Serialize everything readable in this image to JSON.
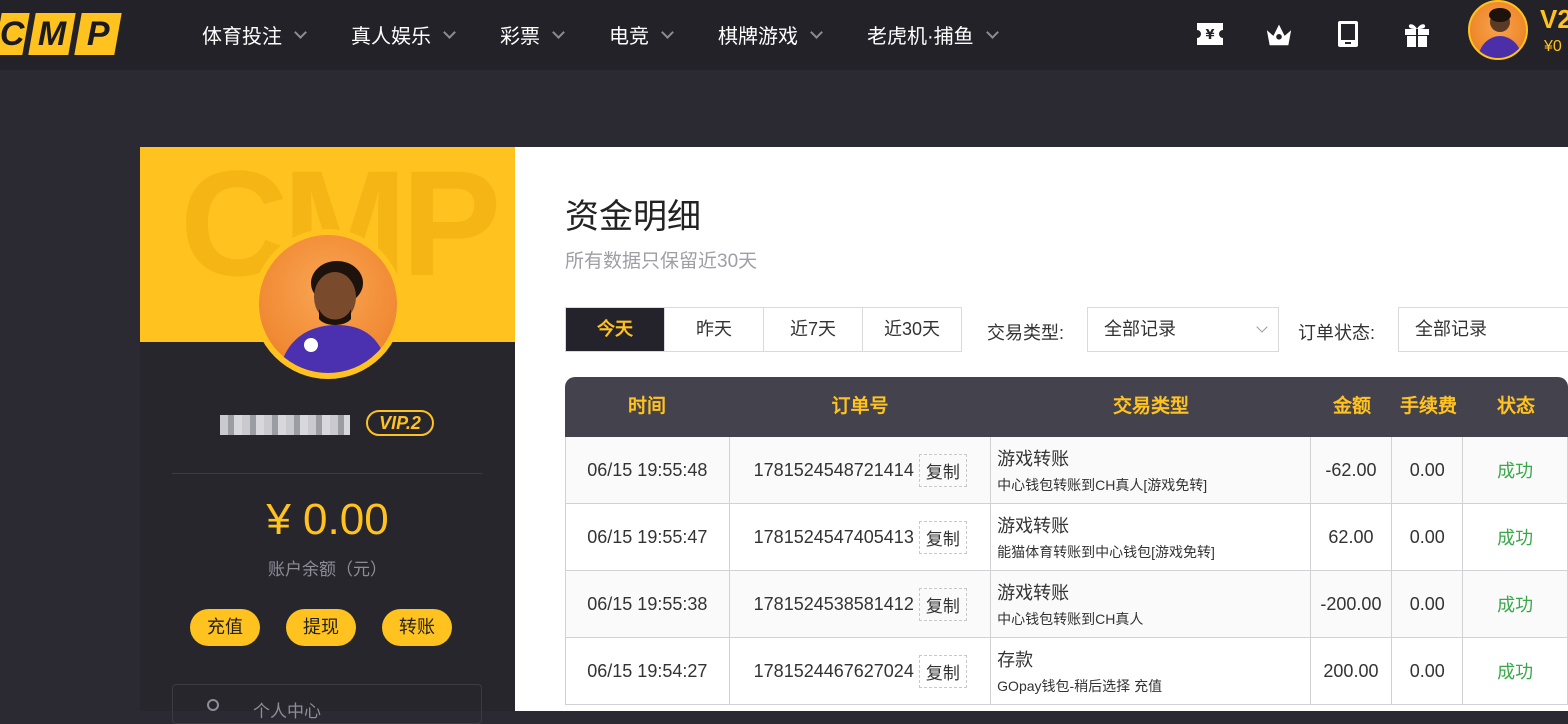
{
  "header": {
    "logo_letters": [
      "C",
      "M",
      "P"
    ],
    "nav": [
      {
        "label": "体育投注"
      },
      {
        "label": "真人娱乐"
      },
      {
        "label": "彩票"
      },
      {
        "label": "电竞"
      },
      {
        "label": "棋牌游戏"
      },
      {
        "label": "老虎机·捕鱼"
      }
    ],
    "icons": [
      "yen-ticket-icon",
      "crown-icon",
      "tablet-icon",
      "gift-icon"
    ],
    "vip": "V2",
    "balance": "¥0"
  },
  "profile": {
    "vip_badge": "VIP.2",
    "balance": "¥ 0.00",
    "balance_label": "账户余额（元）",
    "actions": [
      {
        "label": "充值"
      },
      {
        "label": "提现"
      },
      {
        "label": "转账"
      }
    ],
    "menu_first": "个人中心"
  },
  "main": {
    "title": "资金明细",
    "subtitle": "所有数据只保留近30天",
    "tabs": [
      {
        "label": "今天",
        "active": true
      },
      {
        "label": "昨天"
      },
      {
        "label": "近7天"
      },
      {
        "label": "近30天"
      }
    ],
    "filter_type_label": "交易类型:",
    "filter_type_value": "全部记录",
    "filter_status_label": "订单状态:",
    "filter_status_value": "全部记录",
    "columns": [
      "时间",
      "订单号",
      "交易类型",
      "金额",
      "手续费",
      "状态"
    ],
    "copy_label": "复制",
    "rows": [
      {
        "time": "06/15 19:55:48",
        "order": "1781524548721414",
        "type": "游戏转账",
        "desc": "中心钱包转账到CH真人[游戏免转]",
        "amount": "-62.00",
        "fee": "0.00",
        "status": "成功"
      },
      {
        "time": "06/15 19:55:47",
        "order": "1781524547405413",
        "type": "游戏转账",
        "desc": "能猫体育转账到中心钱包[游戏免转]",
        "amount": "62.00",
        "fee": "0.00",
        "status": "成功"
      },
      {
        "time": "06/15 19:55:38",
        "order": "1781524538581412",
        "type": "游戏转账",
        "desc": "中心钱包转账到CH真人",
        "amount": "-200.00",
        "fee": "0.00",
        "status": "成功"
      },
      {
        "time": "06/15 19:54:27",
        "order": "1781524467627024",
        "type": "存款",
        "desc": "GOpay钱包-稍后选择 充值",
        "amount": "200.00",
        "fee": "0.00",
        "status": "成功"
      }
    ]
  },
  "colors": {
    "accent": "#ffc21f",
    "dark": "#232228",
    "success": "#3aa84a"
  }
}
